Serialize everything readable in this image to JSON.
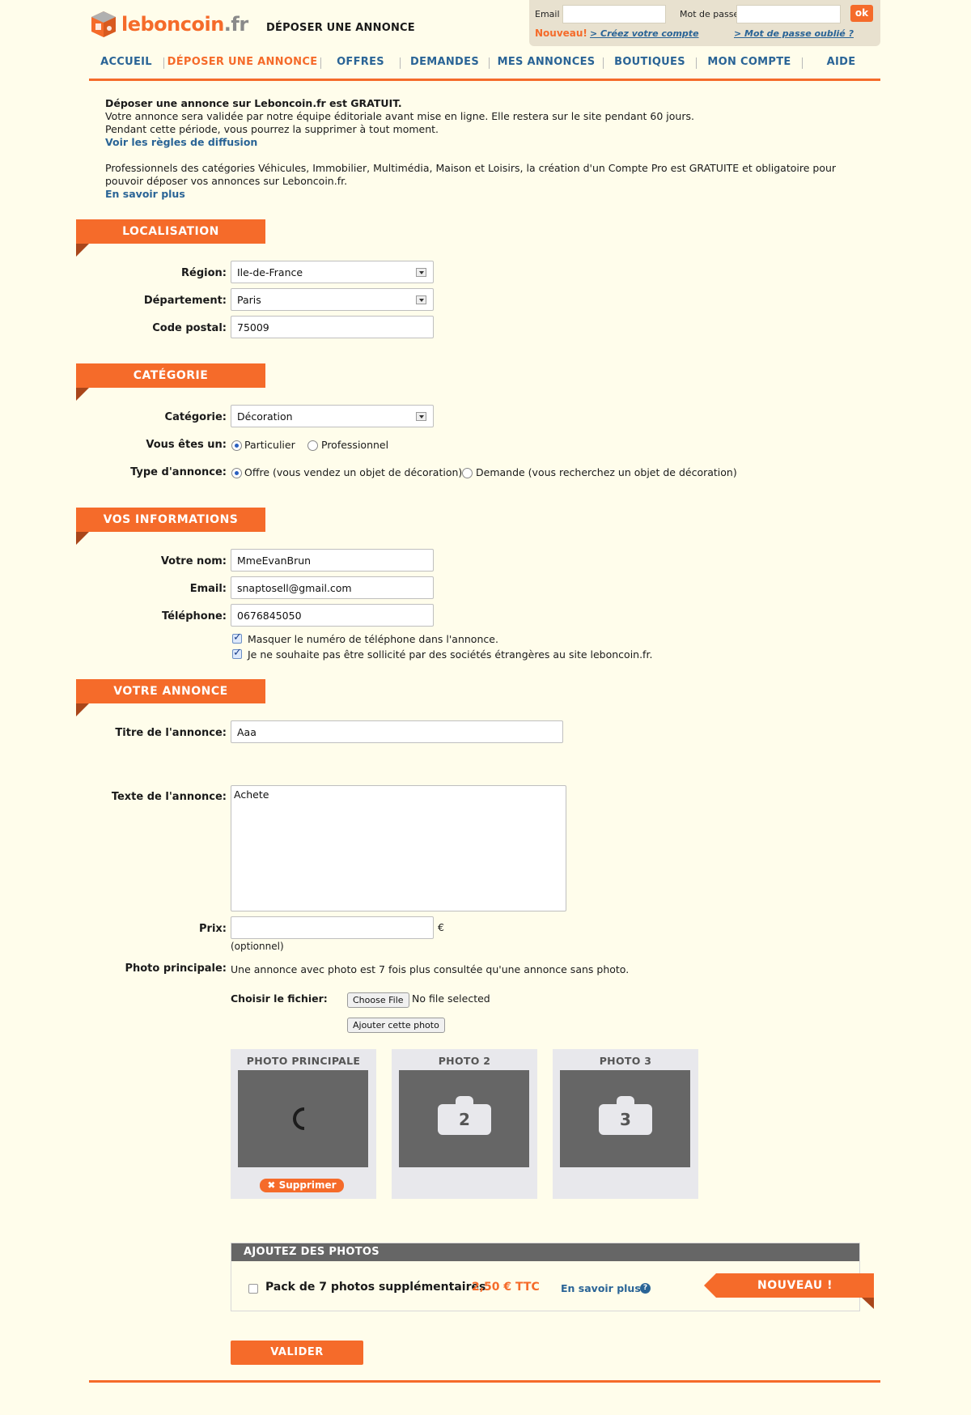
{
  "header": {
    "logo_main": "leboncoin",
    "logo_tld": ".fr",
    "page_title": "DÉPOSER UNE ANNONCE"
  },
  "login": {
    "email_label": "Email",
    "password_label": "Mot de passe",
    "ok_label": "ok",
    "nouveau": "Nouveau!",
    "create_account": "> Créez votre compte",
    "forgot_password": "> Mot de passe oublié ?"
  },
  "nav": {
    "items": [
      {
        "label": "ACCUEIL"
      },
      {
        "label": "DÉPOSER UNE ANNONCE"
      },
      {
        "label": "OFFRES"
      },
      {
        "label": "DEMANDES"
      },
      {
        "label": "MES ANNONCES"
      },
      {
        "label": "BOUTIQUES"
      },
      {
        "label": "MON COMPTE"
      },
      {
        "label": "AIDE"
      }
    ]
  },
  "intro": {
    "headline": "Déposer une annonce sur Leboncoin.fr est GRATUIT.",
    "line1": "Votre annonce sera validée par notre équipe éditoriale avant mise en ligne. Elle restera sur le site pendant 60 jours.",
    "line2": "Pendant cette période, vous pourrez la supprimer à tout moment.",
    "rules_link": "Voir les règles de diffusion",
    "pro_text": "Professionnels des catégories Véhicules, Immobilier, Multimédia, Maison et Loisirs, la création d'un Compte Pro est GRATUITE et obligatoire pour pouvoir déposer vos annonces sur Leboncoin.fr.",
    "learn_more": "En savoir plus"
  },
  "localisation": {
    "section_title": "LOCALISATION",
    "region_label": "Région:",
    "region_value": "Ile-de-France",
    "departement_label": "Département:",
    "departement_value": "Paris",
    "postal_label": "Code postal:",
    "postal_value": "75009"
  },
  "categorie": {
    "section_title": "CATÉGORIE",
    "category_label": "Catégorie:",
    "category_value": "Décoration",
    "you_are_label": "Vous êtes un:",
    "particulier": "Particulier",
    "professionnel": "Professionnel",
    "type_label": "Type d'annonce:",
    "offre": "Offre (vous vendez un objet de décoration)",
    "demande": "Demande (vous recherchez un objet de décoration)"
  },
  "infos": {
    "section_title": "VOS INFORMATIONS",
    "name_label": "Votre nom:",
    "name_value": "MmeEvanBrun",
    "email_label": "Email:",
    "email_value": "snaptosell@gmail.com",
    "phone_label": "Téléphone:",
    "phone_value": "0676845050",
    "hide_phone": "Masquer le numéro de téléphone dans l'annonce.",
    "no_solicit": "Je ne souhaite pas être sollicité par des sociétés étrangères au site leboncoin.fr."
  },
  "annonce": {
    "section_title": "VOTRE ANNONCE",
    "title_label": "Titre de l'annonce:",
    "title_value": "Aaa",
    "text_label": "Texte de l'annonce:",
    "text_value": "Achete",
    "price_label": "Prix:",
    "price_unit": "€",
    "price_optional": "(optionnel)",
    "photo_label": "Photo principale:",
    "photo_hint": "Une annonce avec photo est 7 fois plus consultée qu'une annonce sans photo.",
    "file_label": "Choisir le fichier:",
    "choose_file": "Choose File",
    "no_file": "No file selected",
    "add_photo": "Ajouter cette photo",
    "photos": [
      {
        "title": "PHOTO PRINCIPALE"
      },
      {
        "title": "PHOTO 2",
        "number": "2"
      },
      {
        "title": "PHOTO 3",
        "number": "3"
      }
    ],
    "delete_label": "✖ Supprimer"
  },
  "extra_photos": {
    "bar_title": "AJOUTEZ DES PHOTOS",
    "pack_label": "Pack de 7 photos supplémentaires",
    "pack_price": "2,50 € TTC",
    "learn_more": "En savoir plus",
    "nouveau_tag": "NOUVEAU !"
  },
  "submit_label": "VALIDER",
  "colors": {
    "accent": "#f56b2a",
    "link": "#2a6496",
    "background": "#fffdeb"
  }
}
